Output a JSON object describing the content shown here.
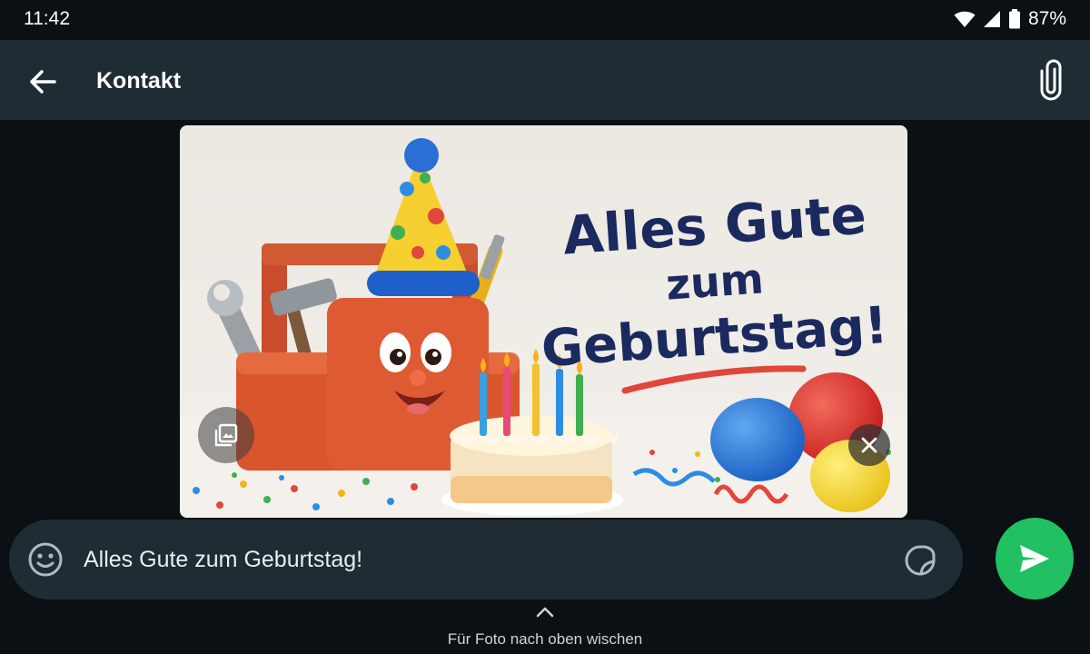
{
  "status_bar": {
    "time": "11:42",
    "battery": "87%",
    "icons": [
      "wifi-icon",
      "cellular-signal-icon",
      "battery-icon"
    ]
  },
  "header": {
    "title": "Kontakt",
    "back_icon": "arrow-left-icon",
    "attach_icon": "paperclip-icon"
  },
  "preview": {
    "headline_line1": "Alles Gute",
    "headline_line2": "zum",
    "headline_line3": "Geburtstag!",
    "gallery_icon": "gallery-icon",
    "remove_icon": "close-icon"
  },
  "composer": {
    "caption_value": "Alles Gute zum Geburtstag!",
    "emoji_icon": "emoji-icon",
    "sticker_icon": "sticker-icon",
    "send_icon": "send-icon"
  },
  "swipe": {
    "hint": "Für Foto nach oben wischen",
    "icon": "chevron-up-icon"
  },
  "colors": {
    "background": "#0b1014",
    "header": "#1f2c34",
    "accent": "#21c063"
  }
}
